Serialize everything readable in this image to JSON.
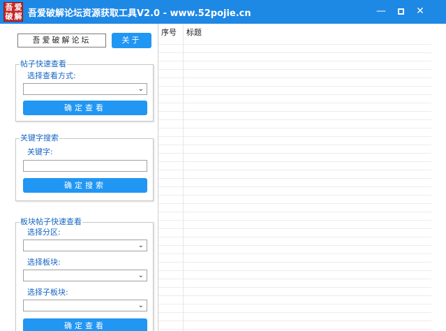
{
  "window": {
    "title": "吾爱破解论坛资源获取工具V2.0 - www.52pojie.cn",
    "logo_chars": [
      "吾",
      "爱",
      "破",
      "解"
    ],
    "min_glyph": "—",
    "close_glyph": "✕"
  },
  "header": {
    "forum_name": "吾爱破解论坛",
    "about_label": "关于"
  },
  "quick_view": {
    "legend": "帖子快速查看",
    "mode_label": "选择查看方式:",
    "mode_value": "",
    "confirm_label": "确定查看"
  },
  "keyword_search": {
    "legend": "关键字搜索",
    "keyword_label": "关键字:",
    "keyword_value": "",
    "search_label": "确定搜索"
  },
  "board_view": {
    "legend": "板块帖子快速查看",
    "zone_label": "选择分区:",
    "zone_value": "",
    "board_label": "选择板块:",
    "board_value": "",
    "subboard_label": "选择子板块:",
    "subboard_value": "",
    "confirm_label": "确定查看"
  },
  "results_table": {
    "columns": [
      "序号",
      "标题"
    ],
    "rows": []
  },
  "colors": {
    "titlebar": "#1e88e5",
    "button": "#2196f3",
    "legend_text": "#1565c0",
    "logo_bg": "#c62828"
  },
  "icons": {
    "dropdown": "chevron-down-icon",
    "minimize": "minimize-icon",
    "maximize": "maximize-icon",
    "close": "close-icon"
  }
}
